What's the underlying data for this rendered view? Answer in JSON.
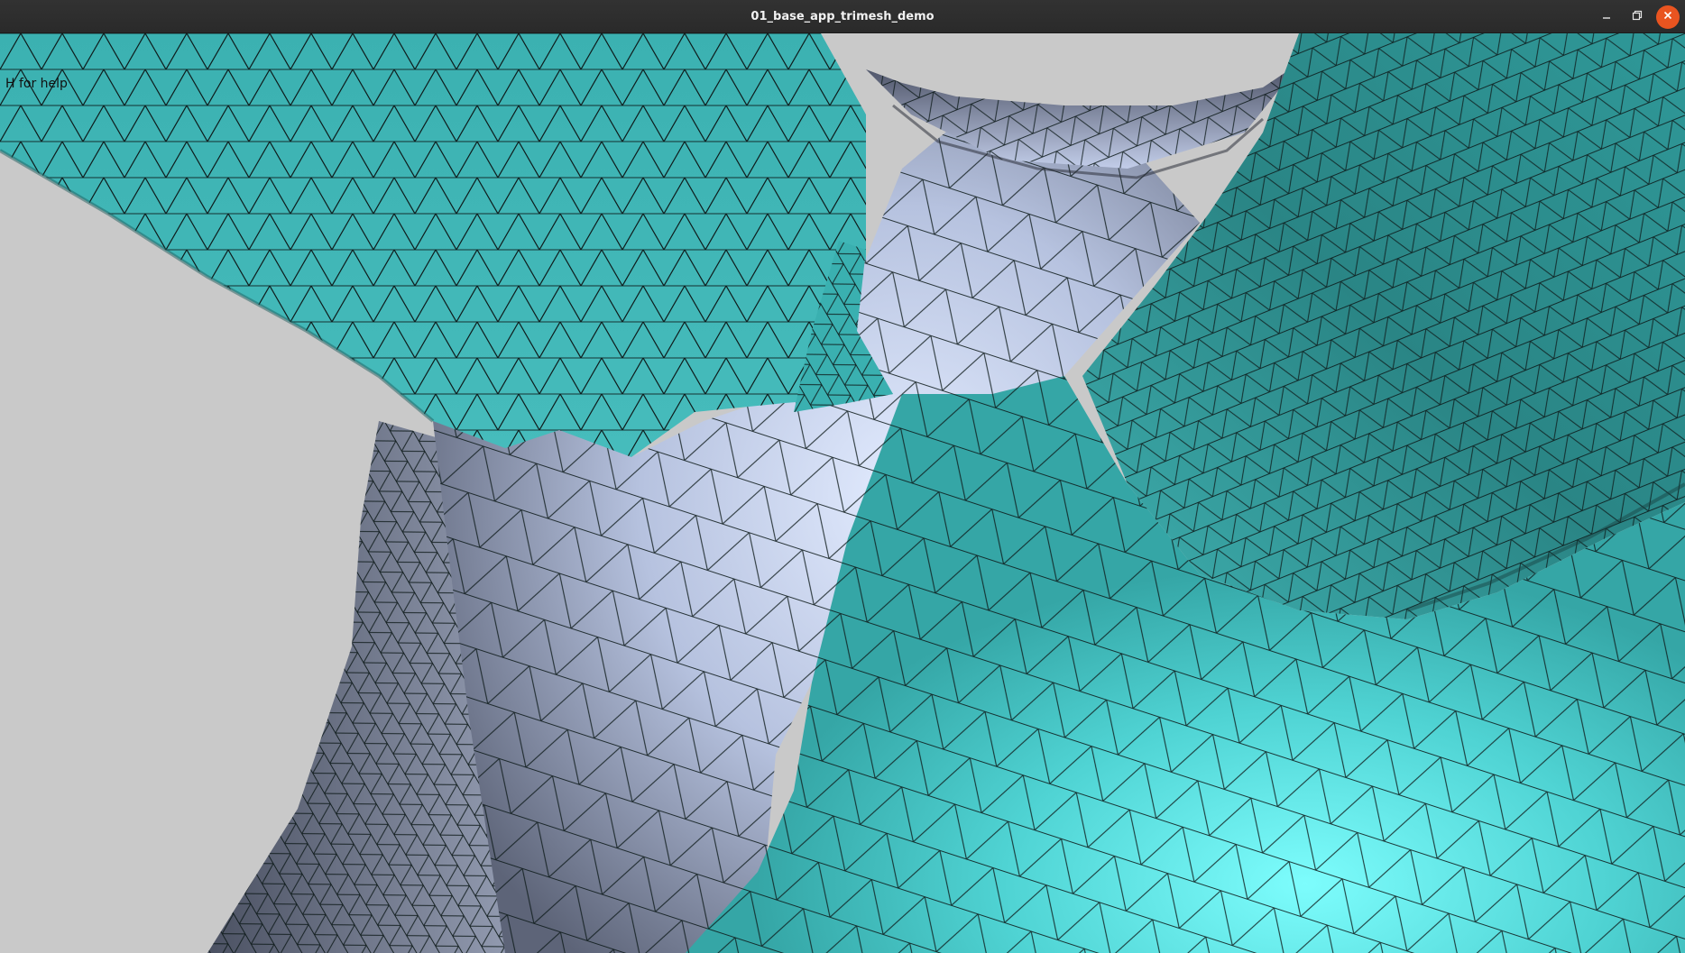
{
  "window": {
    "title": "01_base_app_trimesh_demo",
    "controls": [
      {
        "name": "minimize-icon"
      },
      {
        "name": "maximize-icon"
      },
      {
        "name": "close-icon"
      }
    ]
  },
  "viewport": {
    "help_text": "H for help",
    "background_color": "#c9c9c9",
    "mesh": {
      "colors": {
        "teal": "#3fb6b6",
        "teal_bright": "#6ff2f2",
        "teal_dark": "#2a8585",
        "lavender": "#c8d6f2",
        "lavender_dark": "#5b6275",
        "edge": "#0d1a1a"
      }
    }
  }
}
